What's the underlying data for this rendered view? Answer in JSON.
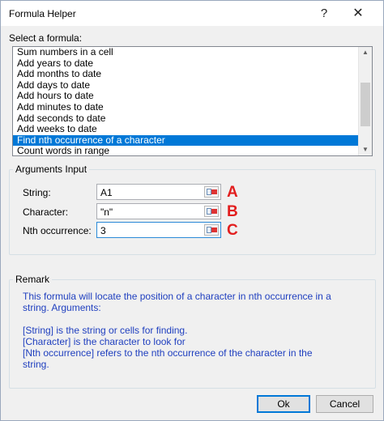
{
  "window": {
    "title": "Formula Helper",
    "help_label": "?",
    "close_label": "✕"
  },
  "formula_list": {
    "label": "Select a formula:",
    "items": [
      {
        "label": "Sum numbers in a cell",
        "selected": false
      },
      {
        "label": "Add years to date",
        "selected": false
      },
      {
        "label": "Add months to date",
        "selected": false
      },
      {
        "label": "Add days to date",
        "selected": false
      },
      {
        "label": "Add hours to date",
        "selected": false
      },
      {
        "label": "Add minutes to date",
        "selected": false
      },
      {
        "label": "Add seconds to date",
        "selected": false
      },
      {
        "label": "Add weeks to date",
        "selected": false
      },
      {
        "label": "Find nth occurrence of a character",
        "selected": true
      },
      {
        "label": "Count words in range",
        "selected": false
      }
    ],
    "selection_color": "#0078d7"
  },
  "arguments": {
    "title": "Arguments Input",
    "string": {
      "label": "String:",
      "value": "A1",
      "annotation": "A"
    },
    "character": {
      "label": "Character:",
      "value": "\"n\"",
      "annotation": "B"
    },
    "nth": {
      "label": "Nth occurrence:",
      "value": "3",
      "annotation": "C"
    },
    "annotation_color": "#e21e1e"
  },
  "remark": {
    "title": "Remark",
    "lines": [
      "This formula will locate the position of a character in nth occurrence in a",
      "string. Arguments:",
      "",
      "[String] is the string or cells for finding.",
      "[Character] is the character to look for",
      "[Nth occurrence] refers to the nth occurrence of the character in the",
      "string."
    ],
    "text_color": "#1f3fbf"
  },
  "buttons": {
    "ok": "Ok",
    "cancel": "Cancel"
  }
}
